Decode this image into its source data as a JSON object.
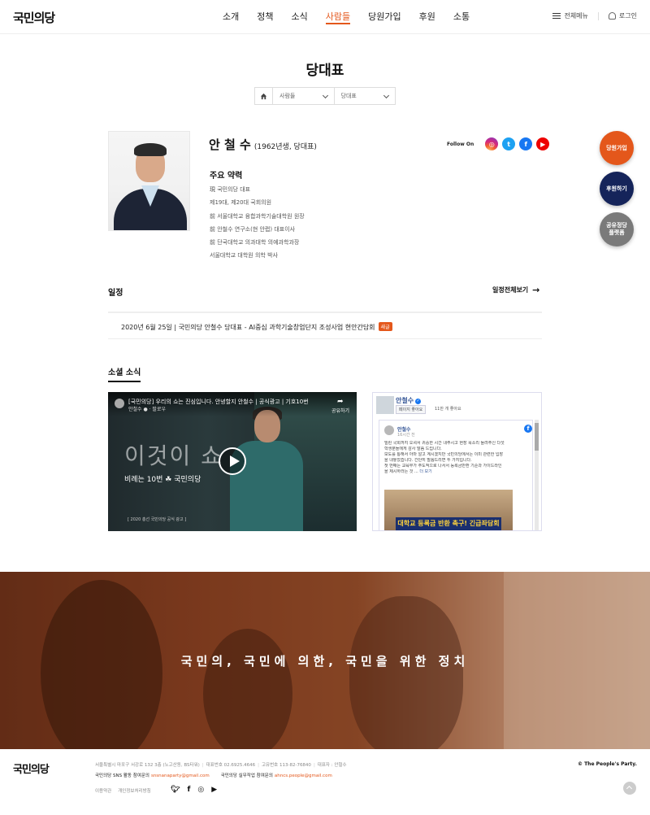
{
  "header": {
    "logo": "국민의당",
    "nav": [
      "소개",
      "정책",
      "소식",
      "사람들",
      "당원가입",
      "후원",
      "소통"
    ],
    "active_nav": "사람들",
    "menu_label": "전체메뉴",
    "login_label": "로그인"
  },
  "page": {
    "title": "당대표",
    "breadcrumb": {
      "level1": "사람들",
      "level2": "당대표"
    }
  },
  "profile": {
    "name": "안 철 수",
    "meta": "(1962년생, 당대표)",
    "follow_label": "Follow On",
    "sns": [
      "instagram-icon",
      "twitter-icon",
      "facebook-icon",
      "youtube-icon"
    ],
    "career_title": "주요 약력",
    "career": [
      "現 국민의당 대표",
      "제19대, 제20대 국회의원",
      "前 서울대학교 융합과학기술대학원 원장",
      "前 안철수 연구소(현 안랩) 대표이사",
      "前 단국대학교 의과대학 의예과학과장",
      "서울대학교 대학원 의학 박사"
    ]
  },
  "schedule": {
    "title": "일정",
    "more_label": "일정전체보기",
    "item_text": "2020년 6월 25일 | 국민의당 안철수 당대표 - AI중심 과학기술창업단지 조성사업 현안간담회",
    "badge": "새글"
  },
  "social": {
    "title": "소셜 소식",
    "video": {
      "title": "[국민의당] 우리의 쇼는 진심입니다. 안녕할지 안철수 | 공식광고 | 기호10번",
      "channel": "안철수 ● · 팔로우",
      "share_label": "공유하기",
      "overlay_big": "이것이 쇼",
      "overlay_sub": "비례는 10번  ☘ 국민의당",
      "caption": "[ 2020 총선 국민의당 공식 광고 ]"
    },
    "facebook": {
      "page_name": "안철수",
      "like_button": "페이지 좋아요",
      "likes": "11만 개 좋아요",
      "post_author": "안철수",
      "post_time": "16시간 전",
      "post_lines": [
        "밀린 국회까지 오셔서 귀중한 시간 내주시고 현장 목소리 들려주신 다섯",
        "학생분들에게 감사 말씀 드립니다.",
        "보도를 통해서 아마 알고 계시겠지만 국민의당에서는 이미 관련한 입장",
        "을 내놓았습니다. 간단히 말씀드리면 두 가지입니다.",
        "첫 번째는 교육부가 주도적으로 나서서 등록금반환 기준과 가이드라인",
        "을 제시하라는 것 ..."
      ],
      "more_link": "더 보기",
      "image_banner": "대학교 등록금 반환 촉구! 긴급좌담회"
    }
  },
  "floating": {
    "join": "당원가입",
    "donate": "후원하기",
    "platform": "공유정당\n플랫폼"
  },
  "banner": {
    "slogan": "국민의, 국민에 의한, 국민을 위한 정치"
  },
  "footer": {
    "logo": "국민의당",
    "address": "서울특별시 마포구 서강로 132 3층 (노고산동, BS타워)",
    "phone": "대표번호  02.6925.4646",
    "fax": "고유번호  113-82-76840",
    "rep": "대표자 : 안철수",
    "contact1_label": "국민의당 SNS 활동 참여문의",
    "contact1_mail": "snsnanaparty@gmail.com",
    "contact2_label": "국민의당 실무작업 참여문의",
    "contact2_mail": "ahncs.people@gmail.com",
    "links": [
      "이용약관",
      "개인정보처리방침"
    ],
    "copyright": "© The People's Party."
  }
}
